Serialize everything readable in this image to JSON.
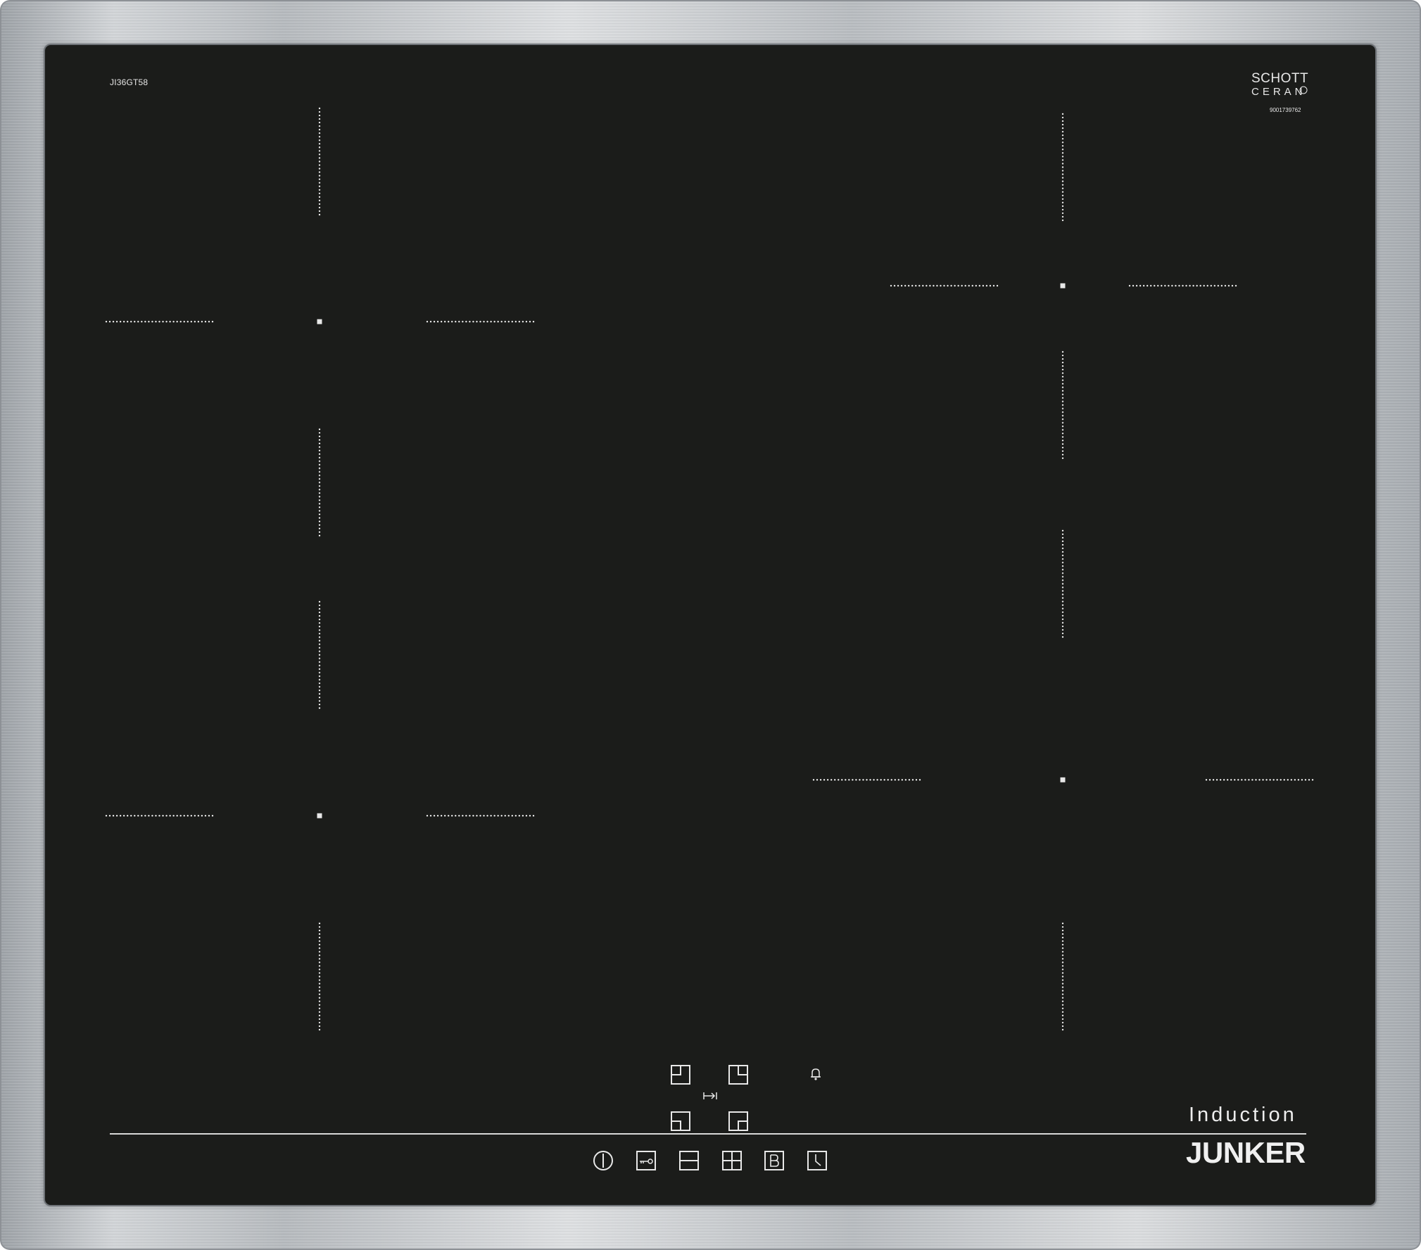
{
  "hob": {
    "model_label": "JI36GT58",
    "glass_brand_top": "SCHOTT",
    "glass_brand_bottom": "CERAN",
    "serial_number": "9001739762",
    "product_type": "Induction",
    "brand_logo_text": "JUNKER"
  },
  "colors": {
    "glass": "#1b1c1a",
    "markings": "#e8e8e8",
    "frame": "#c4c7ca"
  },
  "controls": {
    "zone_selectors": [
      {
        "name": "zone-front-left",
        "icon": "zone-top-left-icon"
      },
      {
        "name": "zone-front-right",
        "icon": "zone-top-right-icon"
      },
      {
        "name": "zone-rear-left",
        "icon": "zone-bottom-left-icon"
      },
      {
        "name": "zone-rear-right",
        "icon": "zone-bottom-right-icon"
      }
    ],
    "move_icon": "move-arrow-icon",
    "timer_alarm_icon": "bell-icon",
    "bottom_row": [
      {
        "name": "power-button",
        "icon": "power-icon"
      },
      {
        "name": "child-lock-button",
        "icon": "key-icon"
      },
      {
        "name": "minus-button",
        "icon": "minus-icon"
      },
      {
        "name": "plus-button",
        "icon": "plus-icon"
      },
      {
        "name": "boost-button",
        "icon": "boost-b-icon"
      },
      {
        "name": "timer-button",
        "icon": "clock-icon"
      }
    ]
  }
}
